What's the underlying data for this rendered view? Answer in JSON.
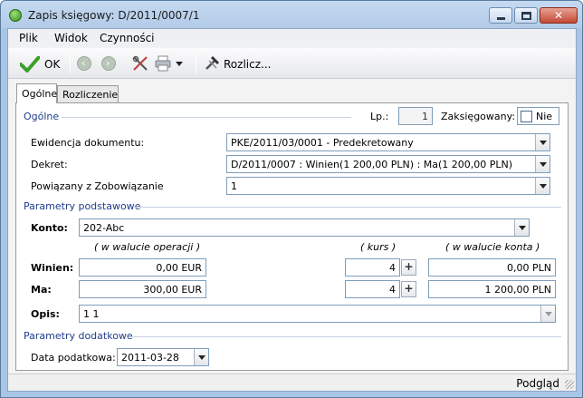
{
  "window": {
    "title": "Zapis księgowy: D/2011/0007/1",
    "close_glyph": "✕"
  },
  "menu": [
    "Plik",
    "Widok",
    "Czynności"
  ],
  "toolbar": {
    "ok_label": "OK",
    "rozlicz_label": "Rozlicz..."
  },
  "tabs": [
    "Ogólne",
    "Rozliczenie"
  ],
  "general": {
    "section_title": "Ogólne",
    "lp_label": "Lp.:",
    "lp_value": "1",
    "zaksiegowany_label": "Zaksięgowany:",
    "zaksiegowany_value": "Nie",
    "ewidencja_label": "Ewidencja dokumentu:",
    "ewidencja_value": "PKE/2011/03/0001 - Predekretowany",
    "dekret_label": "Dekret:",
    "dekret_value": "D/2011/0007 : Winien(1 200,00 PLN) : Ma(1 200,00 PLN)",
    "powiazany_label": "Powiązany z  Zobowiązanie",
    "powiazany_value": "1"
  },
  "basic": {
    "section_title": "Parametry podstawowe",
    "konto_label": "Konto:",
    "konto_value": "202-Abc",
    "col_operation": "( w walucie operacji )",
    "col_kurs": "( kurs )",
    "col_konto": "( w walucie konta )",
    "winien_label": "Winien:",
    "winien_operation": "0,00 EUR",
    "winien_kurs": "4",
    "winien_konto": "0,00 PLN",
    "ma_label": "Ma:",
    "ma_operation": "300,00 EUR",
    "ma_kurs": "4",
    "ma_konto": "1 200,00 PLN",
    "opis_label": "Opis:",
    "opis_value": "1 1"
  },
  "additional": {
    "section_title": "Parametry dodatkowe",
    "data_label": "Data podatkowa:",
    "data_value": "2011-03-28"
  },
  "status": {
    "text": "Podgląd"
  },
  "colors": {
    "accent": "#1f3d8a",
    "title_bar": "#b2cbe8",
    "close_button": "#c24a35"
  }
}
